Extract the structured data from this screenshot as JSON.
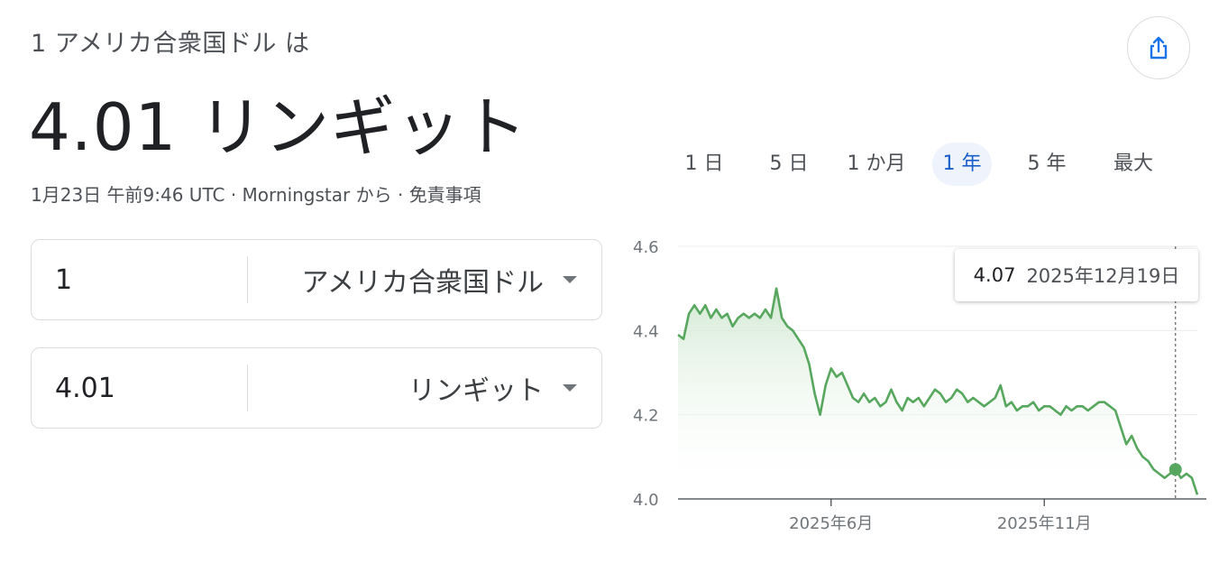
{
  "header": {
    "subtitle": "1 アメリカ合衆国ドル は",
    "result": "4.01 リンギット",
    "timestamp": "1月23日 午前9:46 UTC",
    "separator": "·",
    "source": "Morningstar から",
    "disclaimer": "免責事項"
  },
  "share": {
    "icon": "share-icon"
  },
  "converter": {
    "from": {
      "amount": "1",
      "currency": "アメリカ合衆国ドル"
    },
    "to": {
      "amount": "4.01",
      "currency": "リンギット"
    }
  },
  "ranges": [
    {
      "label": "1 日",
      "active": false
    },
    {
      "label": "5 日",
      "active": false
    },
    {
      "label": "1 か月",
      "active": false
    },
    {
      "label": "1 年",
      "active": true
    },
    {
      "label": "5 年",
      "active": false
    },
    {
      "label": "最大",
      "active": false
    }
  ],
  "tooltip": {
    "value": "4.07",
    "date": "2025年12月19日"
  },
  "colors": {
    "line": "#57a75e",
    "fill_top": "#cfe7d0",
    "active_tab": "#1a5fca",
    "active_tab_bg": "#eef3fc"
  },
  "chart_data": {
    "type": "area",
    "title": "",
    "xlabel": "",
    "ylabel": "",
    "ylim": [
      4.0,
      4.6
    ],
    "yticks": [
      "4.0",
      "4.2",
      "4.4",
      "4.6"
    ],
    "xticks": [
      "2025年6月",
      "2025年11月"
    ],
    "series": [
      {
        "values": [
          4.39,
          4.38,
          4.44,
          4.46,
          4.44,
          4.46,
          4.43,
          4.45,
          4.43,
          4.44,
          4.41,
          4.43,
          4.44,
          4.43,
          4.44,
          4.43,
          4.45,
          4.43,
          4.5,
          4.43,
          4.41,
          4.4,
          4.38,
          4.36,
          4.32,
          4.25,
          4.2,
          4.27,
          4.31,
          4.29,
          4.3,
          4.27,
          4.24,
          4.23,
          4.25,
          4.23,
          4.24,
          4.22,
          4.23,
          4.26,
          4.23,
          4.21,
          4.24,
          4.23,
          4.24,
          4.22,
          4.24,
          4.26,
          4.25,
          4.23,
          4.24,
          4.26,
          4.25,
          4.23,
          4.24,
          4.23,
          4.22,
          4.23,
          4.24,
          4.27,
          4.22,
          4.23,
          4.21,
          4.22,
          4.22,
          4.23,
          4.21,
          4.22,
          4.22,
          4.21,
          4.2,
          4.22,
          4.21,
          4.22,
          4.22,
          4.21,
          4.22,
          4.23,
          4.23,
          4.22,
          4.21,
          4.17,
          4.13,
          4.15,
          4.12,
          4.1,
          4.09,
          4.07,
          4.06,
          4.05,
          4.06,
          4.07,
          4.05,
          4.06,
          4.05,
          4.01
        ]
      }
    ],
    "highlight": {
      "value": 4.07,
      "label": "2025年12月19日"
    }
  }
}
